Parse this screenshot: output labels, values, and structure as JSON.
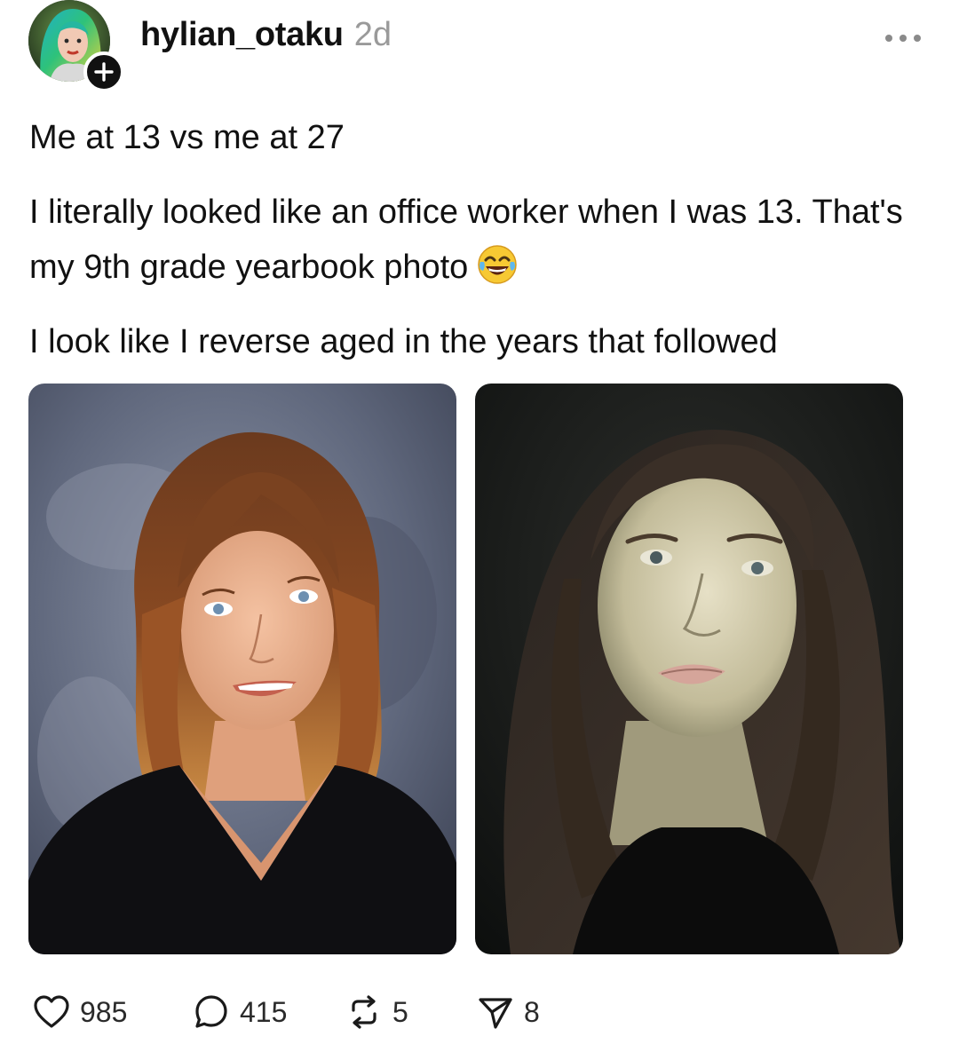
{
  "post": {
    "author": {
      "username": "hylian_otaku",
      "timestamp": "2d",
      "avatar_icon": "user-avatar",
      "follow_icon": "plus-icon"
    },
    "text": {
      "line1": "Me at 13 vs me at 27",
      "line2": "I literally looked like an office worker when I was 13. That's my 9th grade yearbook photo",
      "line2_emoji": "face-with-tears-of-joy",
      "line3": "I look like I reverse aged in the years that followed"
    },
    "media": [
      {
        "kind": "photo",
        "subject": "yearbook-portrait"
      },
      {
        "kind": "photo",
        "subject": "selfie"
      }
    ],
    "actions": {
      "likes": "985",
      "replies": "415",
      "reposts": "5",
      "shares": "8"
    },
    "icons": {
      "like": "heart-icon",
      "reply": "comment-bubble-icon",
      "repost": "repost-arrows-icon",
      "share": "send-paper-plane-icon",
      "more": "more-dots-icon"
    },
    "colors": {
      "text": "#111111",
      "muted": "#9a9a9a",
      "background": "#ffffff"
    }
  }
}
